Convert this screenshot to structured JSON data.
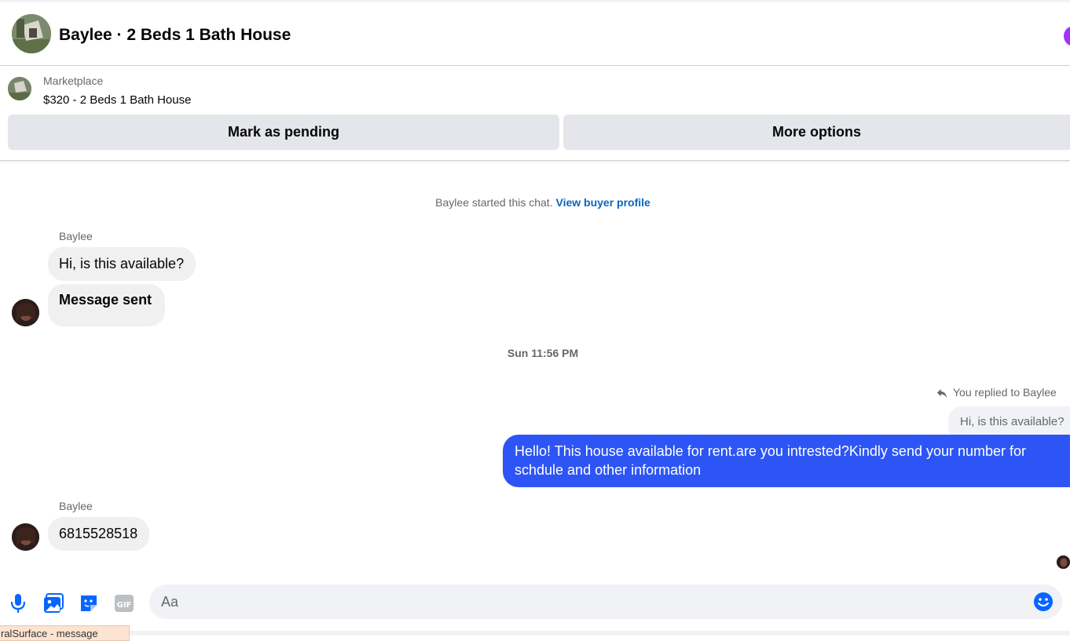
{
  "header": {
    "title": "Baylee · 2 Beds 1 Bath House"
  },
  "marketplace": {
    "label": "Marketplace",
    "listing_title": "$320 - 2 Beds 1 Bath House",
    "mark_pending_label": "Mark as pending",
    "more_options_label": "More options"
  },
  "chat": {
    "started_text": "Baylee started this chat.",
    "view_profile_link": "View buyer profile",
    "group1": {
      "sender": "Baylee",
      "messages": [
        "Hi, is this available?",
        "Message sent"
      ]
    },
    "timestamp": "Sun 11:56 PM",
    "reply": {
      "replied_label": "You replied to Baylee",
      "quoted_text": "Hi, is this available?",
      "outgoing_text": "Hello! This house available for rent.are you intrested?Kindly send your number for schdule and other information"
    },
    "group2": {
      "sender": "Baylee",
      "messages": [
        "6815528518"
      ]
    }
  },
  "composer": {
    "placeholder": "Aa",
    "tools": [
      "microphone-icon",
      "photo-icon",
      "sticker-icon",
      "gif-icon"
    ],
    "gif_label": "GIF",
    "emoji": "smiley-icon"
  },
  "tooltip": {
    "text": "ralSurface - message"
  },
  "colors": {
    "accent_blue": "#0a66c2",
    "outgoing_bubble": "#2d55f5",
    "icon_blue": "#0866ff",
    "incoming_bubble": "#f0f0f0",
    "button_gray": "#e4e6eb"
  }
}
